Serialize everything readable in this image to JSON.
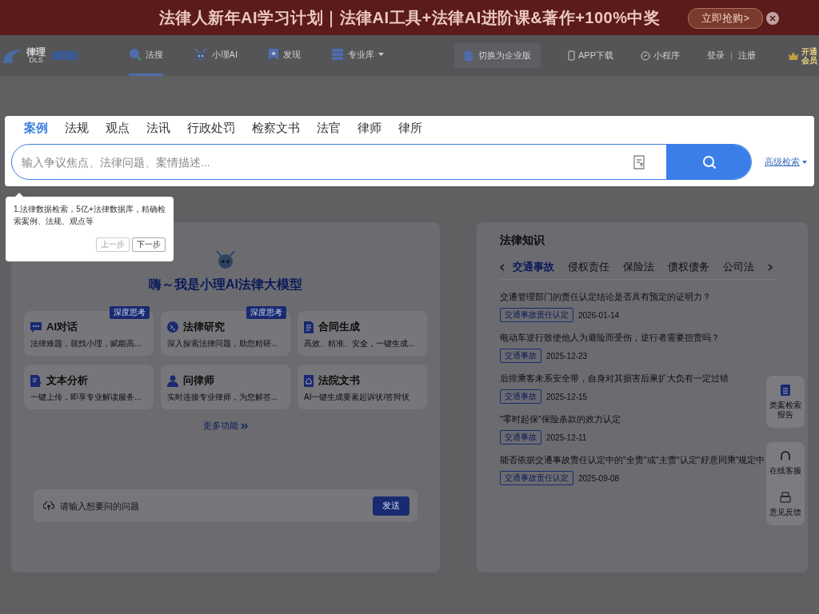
{
  "banner": {
    "text": "法律人新年AI学习计划｜法律AI工具+法律AI进阶课&著作+100%中奖",
    "button": "立即抢购>"
  },
  "nav": {
    "logo_text": "律理",
    "logo_sub": "DLS",
    "items": [
      {
        "label": "法搜",
        "selected": true,
        "dropdown": false
      },
      {
        "label": "小理AI",
        "selected": false,
        "dropdown": false
      },
      {
        "label": "发现",
        "selected": false,
        "dropdown": false
      },
      {
        "label": "专业库",
        "selected": false,
        "dropdown": true
      }
    ],
    "enterprise": "切换为企业版",
    "links": [
      "APP下载",
      "小程序"
    ],
    "login": "登录",
    "register": "注册",
    "vip": "开通会员"
  },
  "search": {
    "tabs": [
      {
        "label": "案例",
        "selected": true
      },
      {
        "label": "法规",
        "selected": false
      },
      {
        "label": "观点",
        "selected": false
      },
      {
        "label": "法讯",
        "selected": false
      },
      {
        "label": "行政处罚",
        "selected": false
      },
      {
        "label": "检察文书",
        "selected": false
      },
      {
        "label": "法官",
        "selected": false
      },
      {
        "label": "律师",
        "selected": false
      },
      {
        "label": "律所",
        "selected": false
      }
    ],
    "placeholder": "输入争议焦点、法律问题、案情描述...",
    "advanced": "高级检索"
  },
  "guide": {
    "text": "1.法律数据检索，5亿+法律数据库，精确检索案例、法规、观点等",
    "prev": {
      "label": "上一步",
      "disabled": true
    },
    "next": {
      "label": "下一步",
      "disabled": false
    }
  },
  "ai": {
    "title": "嗨～我是小理AI法律大模型",
    "features": [
      {
        "title": "AI对话",
        "desc": "法律难题，就找小理，赋能高...",
        "badge": "深度思考"
      },
      {
        "title": "法律研究",
        "desc": "深入探索法律问题，助您精研...",
        "badge": "深度思考"
      },
      {
        "title": "合同生成",
        "desc": "高效、精准、安全，一键生成..."
      },
      {
        "title": "文本分析",
        "desc": "一键上传，即享专业解读服务..."
      },
      {
        "title": "问律师",
        "desc": "实时连接专业律师，为您解答..."
      },
      {
        "title": "法院文书",
        "desc": "AI一键生成要素起诉状/答辩状"
      }
    ],
    "more": "更多功能",
    "placeholder": "请输入想要问的问题",
    "send": "发送"
  },
  "knowledge": {
    "title": "法律知识",
    "tabs": [
      {
        "label": "交通事故",
        "selected": true
      },
      {
        "label": "侵权责任",
        "selected": false
      },
      {
        "label": "保险法",
        "selected": false
      },
      {
        "label": "债权债务",
        "selected": false
      },
      {
        "label": "公司法",
        "selected": false
      }
    ],
    "items": [
      {
        "title": "交通管理部门的责任认定结论是否具有预定的证明力？",
        "tag": "交通事故责任认定",
        "date": "2026-01-14"
      },
      {
        "title": "电动车逆行致使他人为避险而受伤，逆行者需要担责吗？",
        "tag": "交通事故",
        "date": "2025-12-23"
      },
      {
        "title": "后排乘客未系安全带，自身对其损害后果扩大负有一定过错",
        "tag": "交通事故",
        "date": "2025-12-15"
      },
      {
        "title": "\"零时起保\"保险条款的效力认定",
        "tag": "交通事故",
        "date": "2025-12-11"
      },
      {
        "title": "能否依据交通事故责任认定中的\"全责\"或\"主责\"认定\"好意同乘\"规定中",
        "tag": "交通事故责任认定",
        "date": "2025-09-08"
      }
    ]
  },
  "side_tools": [
    "类案检索报告",
    "在线客服",
    "意见反馈"
  ]
}
